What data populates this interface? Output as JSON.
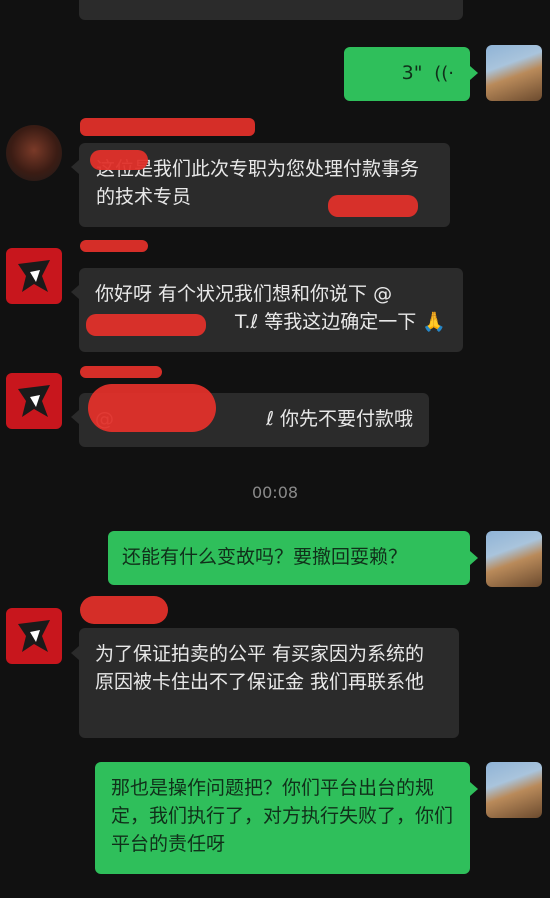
{
  "messages": {
    "m0": {
      "direction": "incoming",
      "text": ""
    },
    "m1": {
      "direction": "outgoing",
      "duration": "3\"",
      "wave_icon": "voice-wave-icon"
    },
    "m2": {
      "direction": "incoming",
      "text": "这位是我们此次专职为您处理付款事务的技术专员"
    },
    "m3": {
      "direction": "incoming",
      "line1": "你好呀 有个状况我们想和你说下 @",
      "line2": "T.ℓ 等我这边确定一下",
      "emoji": "🙏"
    },
    "m4": {
      "direction": "incoming",
      "prefix": "@",
      "suffix": "ℓ 你先不要付款哦"
    },
    "m5": {
      "direction": "outgoing",
      "text": "还能有什么变故吗？要撤回耍赖？"
    },
    "m6": {
      "direction": "incoming",
      "text": "为了保证拍卖的公平 有买家因为系统的原因被卡住出不了保证金 我们再联系他"
    },
    "m7": {
      "direction": "outgoing",
      "text": "那也是操作问题把？你们平台出台的规定，我们执行了，对方执行失败了，你们平台的责任呀"
    }
  },
  "timestamp": "00:08",
  "colors": {
    "outgoing_bubble": "#2fbf5b",
    "incoming_bubble": "#2b2b2b",
    "redaction": "#e0302a",
    "background": "#111111"
  }
}
